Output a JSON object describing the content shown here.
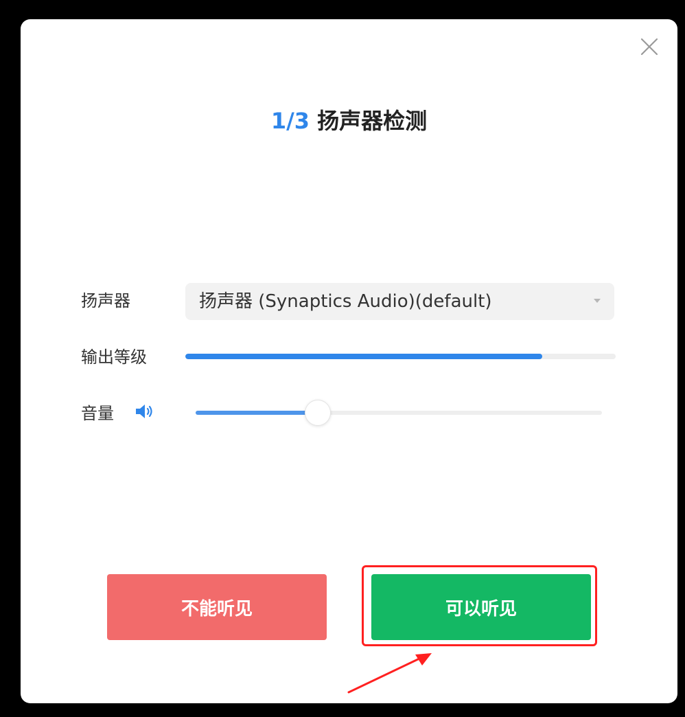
{
  "dialog": {
    "close_icon": "close-icon",
    "title": {
      "step": "1/3",
      "text": " 扬声器检测"
    },
    "speaker": {
      "label": "扬声器",
      "selected": "扬声器 (Synaptics Audio)(default)"
    },
    "output_level": {
      "label": "输出等级",
      "level": 0.83
    },
    "volume": {
      "label": "音量",
      "icon": "speaker-volume-icon",
      "value": 0.3
    },
    "buttons": {
      "cannot_hear": "不能听见",
      "can_hear": "可以听见"
    }
  },
  "colors": {
    "accent": "#2f86ea",
    "cannot_hear_bg": "#f26b6b",
    "can_hear_bg": "#14b864",
    "annotation": "#ff2020"
  }
}
